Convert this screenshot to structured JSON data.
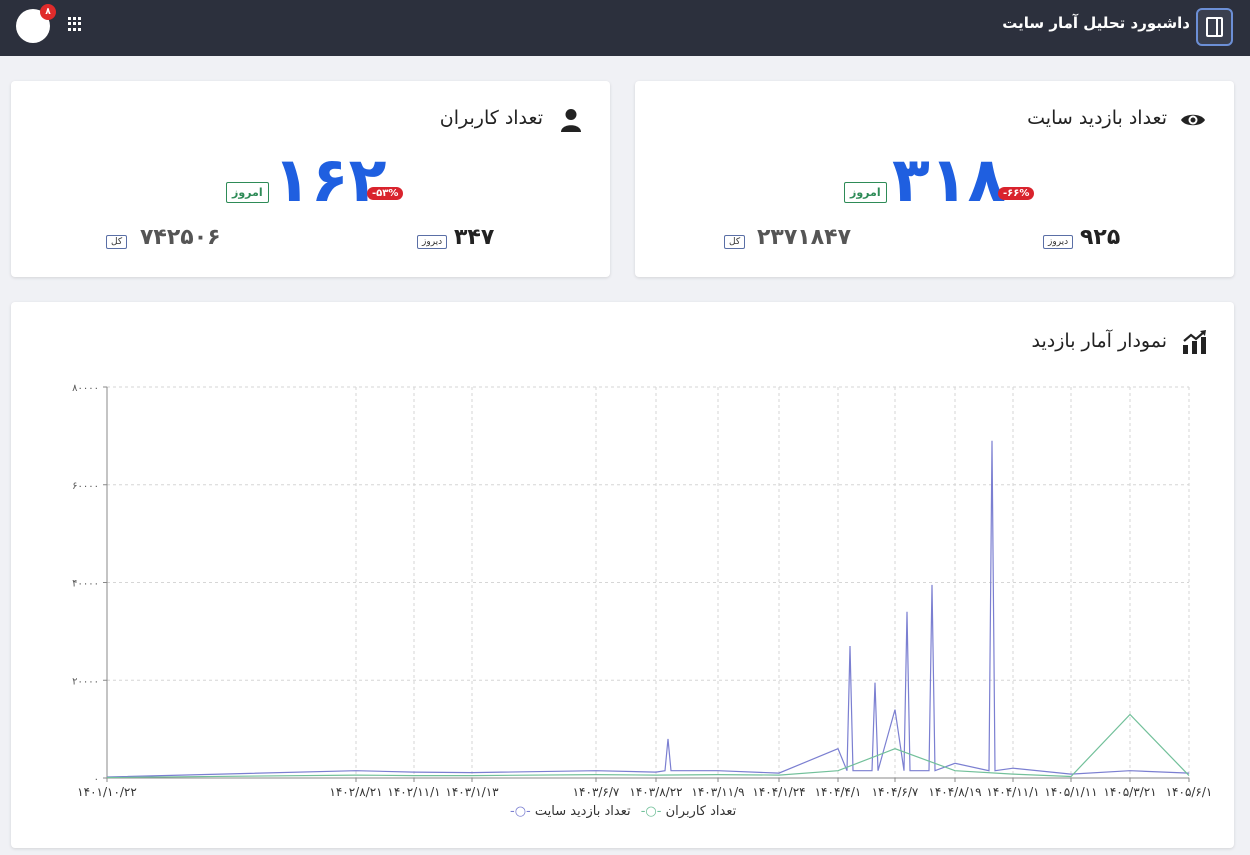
{
  "header": {
    "title": "داشبورد تحلیل آمار سایت",
    "notification_count": "۸",
    "icons": {
      "sidebar_toggle": "sidebar-toggle-icon",
      "apps": "apps-grid-icon",
      "avatar": "user-avatar"
    }
  },
  "cards": {
    "visits": {
      "title": "تعداد بازدید سایت",
      "icon": "eye-icon",
      "today_value": "۳۱۸",
      "today_label": "امروز",
      "change_pct": "-۶۶%",
      "yesterday_value": "۹۲۵",
      "yesterday_label": "دیروز",
      "total_value": "۲۳۷۱۸۴۷",
      "total_label": "کل"
    },
    "users": {
      "title": "تعداد کاربران",
      "icon": "user-icon",
      "today_value": "۱۶۲",
      "today_label": "امروز",
      "change_pct": "-۵۳%",
      "yesterday_value": "۳۴۷",
      "yesterday_label": "دیروز",
      "total_value": "۷۴۲۵۰۶",
      "total_label": "کل"
    }
  },
  "chart_section": {
    "title": "نمودار آمار بازدید",
    "icon": "chart-trend-icon"
  },
  "chart_data": {
    "type": "line",
    "title": "",
    "xlabel": "",
    "ylabel": "",
    "ylim": [
      0,
      80000
    ],
    "y_ticks": [
      "۰",
      "۲۰۰۰۰",
      "۴۰۰۰۰",
      "۶۰۰۰۰",
      "۸۰۰۰۰"
    ],
    "x_ticks": [
      "۱۴۰۱/۱۰/۲۲",
      "۱۴۰۲/۸/۲۱",
      "۱۴۰۲/۱۱/۱",
      "۱۴۰۳/۱/۱۳",
      "۱۴۰۳/۶/۷",
      "۱۴۰۳/۸/۲۲",
      "۱۴۰۳/۱۱/۹",
      "۱۴۰۴/۱/۲۴",
      "۱۴۰۴/۴/۱",
      "۱۴۰۴/۶/۷",
      "۱۴۰۴/۸/۱۹",
      "۱۴۰۴/۱۱/۱",
      "۱۴۰۵/۱/۱۱",
      "۱۴۰۵/۳/۲۱",
      "۱۴۰۵/۶/۱"
    ],
    "grid": true,
    "legend_position": "bottom",
    "series": [
      {
        "name": "تعداد بازدید سایت",
        "color": "#7b7fd1",
        "values": [
          [
            "۱۴۰۱/۱۰/۲۲",
            200
          ],
          [
            "۱۴۰۲/۸/۲۱",
            1500
          ],
          [
            "۱۴۰۲/۱۱/۱",
            1200
          ],
          [
            "۱۴۰۳/۱/۱۳",
            1100
          ],
          [
            "۱۴۰۳/۶/۷",
            1500
          ],
          [
            "۱۴۰۳/۸/۲۲",
            1200
          ],
          [
            "۱۴۰۳/۱۱/۹",
            1500
          ],
          [
            "۱۴۰۴/۱/۲۴",
            1000
          ],
          [
            "۱۴۰۴/۴/۱",
            6000
          ],
          [
            "۱۴۰۴/۶/۷",
            14000
          ],
          [
            "۱۴۰۴/۸/۱۹",
            3000
          ],
          [
            "۱۴۰۴/۱۱/۱",
            2000
          ],
          [
            "۱۴۰۵/۱/۱۱",
            800
          ],
          [
            "۱۴۰۵/۳/۲۱",
            1500
          ],
          [
            "۱۴۰۵/۶/۱",
            1000
          ]
        ],
        "peaks": [
          [
            "۱۴۰۳/۸/۲۲",
            8000
          ],
          [
            "۱۴۰۴/۴/۱",
            19500
          ],
          [
            "۱۴۰۴/۴/۱",
            27000
          ],
          [
            "۱۴۰۴/۶/۷",
            39500
          ],
          [
            "۱۴۰۴/۶/۷",
            34000
          ],
          [
            "۱۴۰۴/۸/۱۹",
            69000
          ]
        ]
      },
      {
        "name": "تعداد کاربران",
        "color": "#72c09a",
        "values": [
          [
            "۱۴۰۱/۱۰/۲۲",
            100
          ],
          [
            "۱۴۰۲/۸/۲۱",
            600
          ],
          [
            "۱۴۰۲/۱۱/۱",
            500
          ],
          [
            "۱۴۰۳/۱/۱۳",
            500
          ],
          [
            "۱۴۰۳/۶/۷",
            700
          ],
          [
            "۱۴۰۳/۸/۲۲",
            600
          ],
          [
            "۱۴۰۳/۱۱/۹",
            700
          ],
          [
            "۱۴۰۴/۱/۲۴",
            600
          ],
          [
            "۱۴۰۴/۴/۱",
            1500
          ],
          [
            "۱۴۰۴/۶/۷",
            6000
          ],
          [
            "۱۴۰۴/۸/۱۹",
            1500
          ],
          [
            "۱۴۰۴/۱۱/۱",
            800
          ],
          [
            "۱۴۰۵/۱/۱۱",
            300
          ],
          [
            "۱۴۰۵/۳/۲۱",
            13000
          ],
          [
            "۱۴۰۵/۶/۱",
            500
          ]
        ]
      }
    ]
  }
}
